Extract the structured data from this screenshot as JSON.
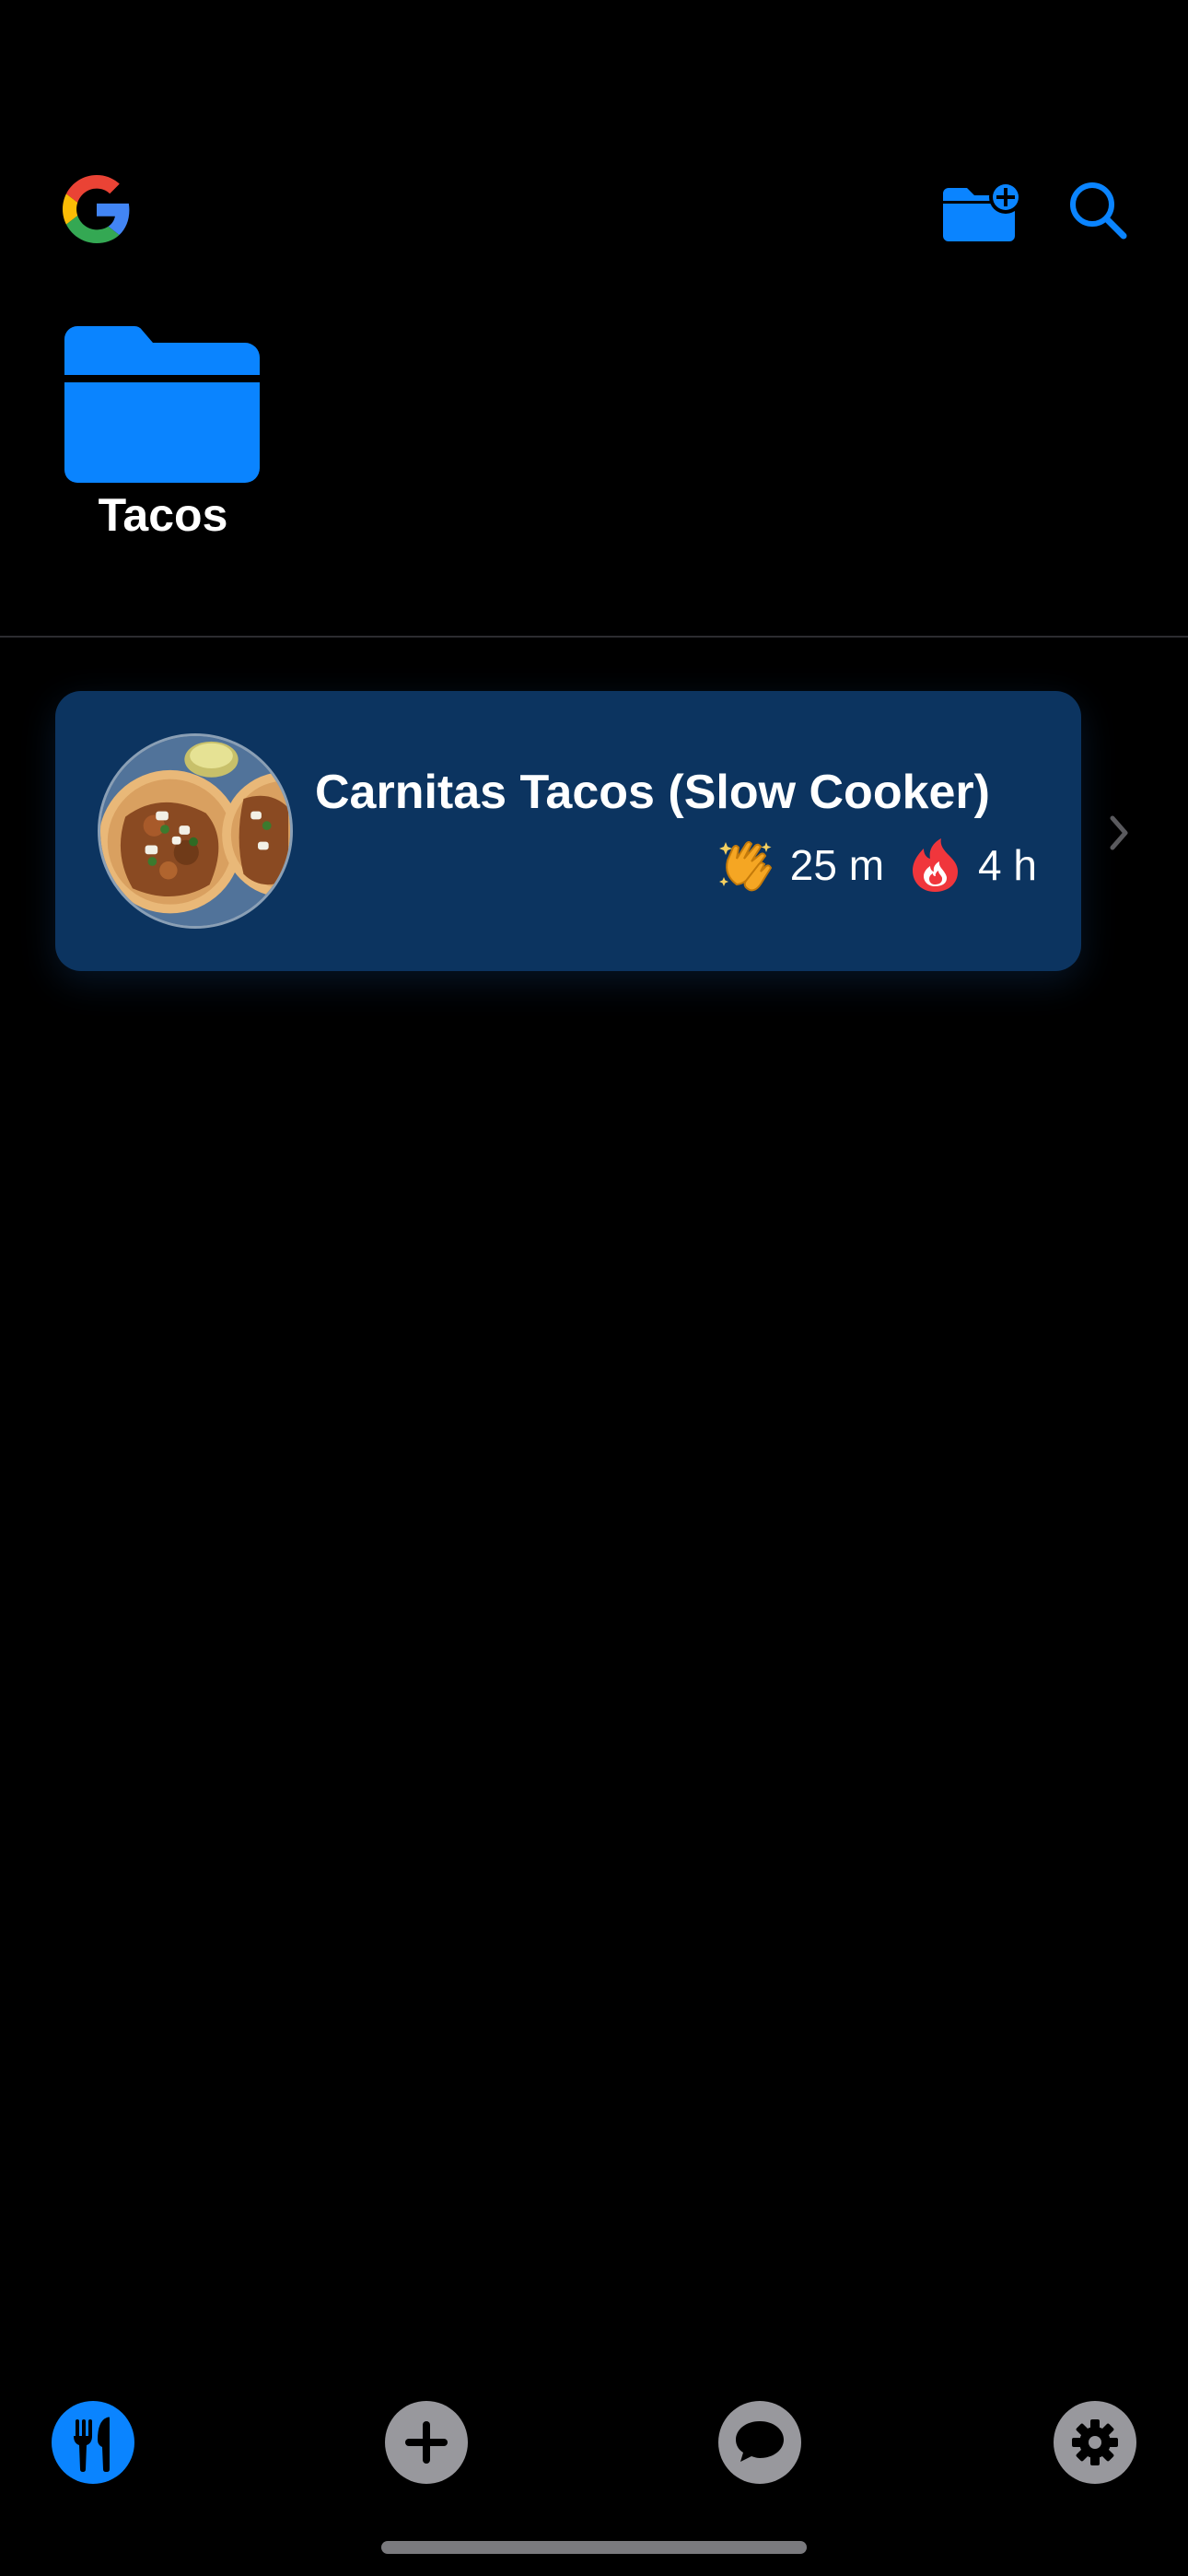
{
  "header": {
    "logo_icon": "google-g-icon",
    "new_folder_icon": "folder-plus-icon",
    "search_icon": "search-icon",
    "accent_color": "#0a84ff"
  },
  "folders": [
    {
      "name": "Tacos",
      "icon": "folder-icon"
    }
  ],
  "recipes": [
    {
      "title": "Carnitas Tacos (Slow Cooker)",
      "prep_icon": "clapping-hands-icon",
      "prep_time": "25 m",
      "cook_icon": "fire-icon",
      "cook_time": "4 h",
      "card_color": "#0c3460"
    }
  ],
  "tab_bar": {
    "tabs": [
      {
        "name": "recipes",
        "icon": "fork-knife-icon",
        "selected": true
      },
      {
        "name": "add",
        "icon": "plus-icon",
        "selected": false
      },
      {
        "name": "chat",
        "icon": "speech-bubble-icon",
        "selected": false
      },
      {
        "name": "settings",
        "icon": "gear-icon",
        "selected": false
      }
    ],
    "selected_color": "#0a84ff",
    "unselected_color": "#98989d"
  }
}
